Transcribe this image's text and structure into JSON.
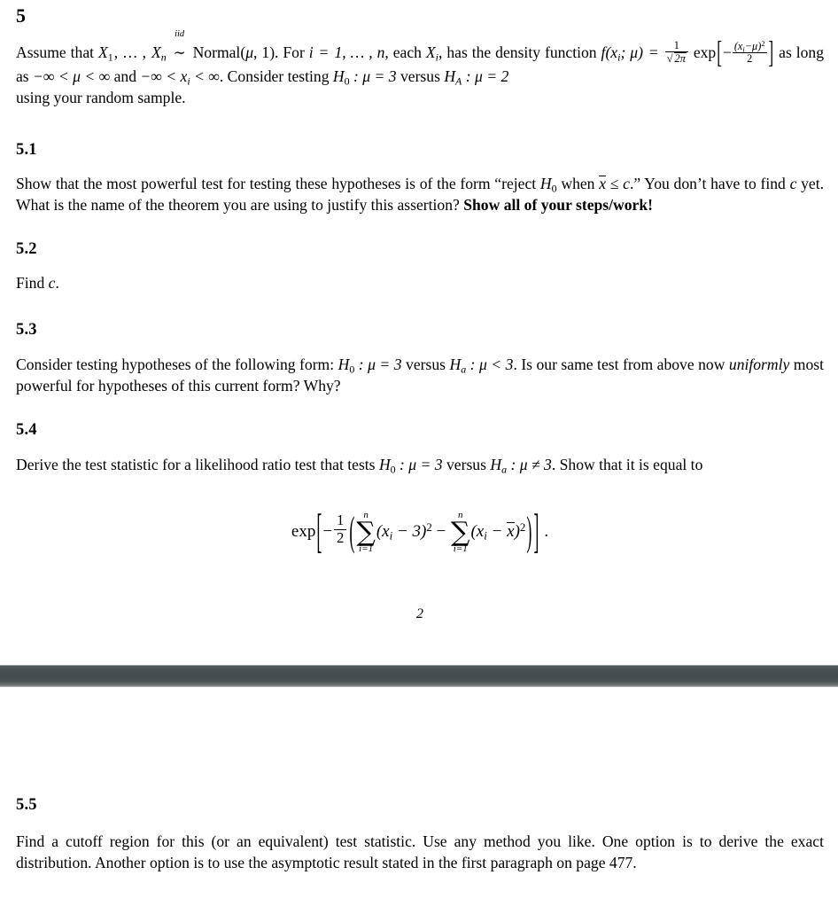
{
  "document": {
    "page_one": {
      "main_heading": "5",
      "intro": {
        "prefix": "Assume that ",
        "vars": "X",
        "sub1": "1",
        "mid": ", … , ",
        "varn": "X",
        "subn": "n",
        "iid_label": "iid",
        "sim_symbol": "∼",
        "dist_name": "Normal",
        "dist_args_open": "(",
        "dist_mu": "μ",
        "dist_comma": ", ",
        "dist_one": "1",
        "dist_args_close": ")",
        "sentence2_a": ".  For ",
        "i_var": "i",
        "eq": " = ",
        "range": "1, … , n",
        "sentence2_b": ", each ",
        "xi": "X",
        "xi_sub": "i",
        "sentence2_c": ", has the density function ",
        "f_name": "f",
        "f_args": "(x",
        "f_sub": "i",
        "f_semi": "; μ)",
        "f_equals": " = ",
        "frac_num": "1",
        "frac_sqrt": "√",
        "frac_den": "2π",
        "exp_label": "exp",
        "exp_minus": "−",
        "exp_num": "(x",
        "exp_num_sub": "i",
        "exp_num_mu": "−μ)",
        "exp_num_pow": "2",
        "exp_den": "2",
        "sentence3_a": " as long as ",
        "cond1": "−∞ < μ < ∞",
        "and_word": " and ",
        "cond2_a": "−∞ < x",
        "cond2_sub": "i",
        "cond2_b": " < ∞",
        "sentence3_b": ". Consider testing ",
        "h0": "H",
        "h0_sub": "0",
        "h0_rest": " : μ = 3",
        "versus": " versus ",
        "hA": "H",
        "hA_sub": "A",
        "hA_rest": " : μ = 2",
        "sentence4": "using your random sample."
      },
      "sections": [
        {
          "id": "5.1",
          "heading": "5.1",
          "text_parts": {
            "a": "Show that the most powerful test for testing these hypotheses is of the form “reject ",
            "h0": "H",
            "h0_sub": "0",
            "b": " when ",
            "xbar": "x",
            "c": " ≤ ",
            "c_var": "c",
            "d": ".” You don’t have to find ",
            "c_var2": "c",
            "e": " yet. What is the name of the theorem you are using to justify this assertion? ",
            "bold_tail": "Show all of your steps/work!"
          }
        },
        {
          "id": "5.2",
          "heading": "5.2",
          "text_parts": {
            "a": "Find ",
            "c_var": "c",
            "b": "."
          }
        },
        {
          "id": "5.3",
          "heading": "5.3",
          "text_parts": {
            "a": "Consider testing hypotheses of the following form:  ",
            "h0": "H",
            "h0_sub": "0",
            "h0_rest": " : μ = 3",
            "versus": " versus ",
            "ha": "H",
            "ha_sub": "a",
            "ha_rest": " : μ < 3",
            "b": ". Is our same test from above now ",
            "italic_word": "uniformly",
            "c": " most powerful for hypotheses of this current form?  Why?"
          }
        },
        {
          "id": "5.4",
          "heading": "5.4",
          "text_parts": {
            "a": "Derive the test statistic for a likelihood ratio test that tests ",
            "h0": "H",
            "h0_sub": "0",
            "h0_rest": " : μ = 3",
            "versus": " versus ",
            "ha": "H",
            "ha_sub": "a",
            "ha_rest": " : μ ≠ 3",
            "b": ". Show that it is equal to"
          },
          "equation": {
            "exp_label": "exp",
            "open_bracket": "[",
            "minus": "−",
            "frac_num": "1",
            "frac_den": "2",
            "open_paren": "(",
            "sum1_symbol": "∑",
            "sum1_above": "n",
            "sum1_below": "i=1",
            "term1": "(x",
            "term1_sub": "i",
            "term1_rest": " − 3)",
            "term1_pow": "2",
            "middle_minus": " − ",
            "sum2_symbol": "∑",
            "sum2_above": "n",
            "sum2_below": "i=1",
            "term2": "(x",
            "term2_sub": "i",
            "term2_mid": " − ",
            "term2_xbar": "x",
            "term2_rest": ")",
            "term2_pow": "2",
            "close_paren": ")",
            "close_bracket": "]",
            "period": "."
          }
        }
      ],
      "page_number": "2"
    },
    "page_two": {
      "sections": [
        {
          "id": "5.5",
          "heading": "5.5",
          "text": "Find a cutoff region for this (or an equivalent) test statistic. Use any method you like. One option is to derive the exact distribution. Another option is to use the asymptotic result stated in the first paragraph on page 477."
        }
      ]
    }
  },
  "colors": {
    "page_background": "#ffffff",
    "text": "#000000",
    "page_separator": "#474e51"
  }
}
